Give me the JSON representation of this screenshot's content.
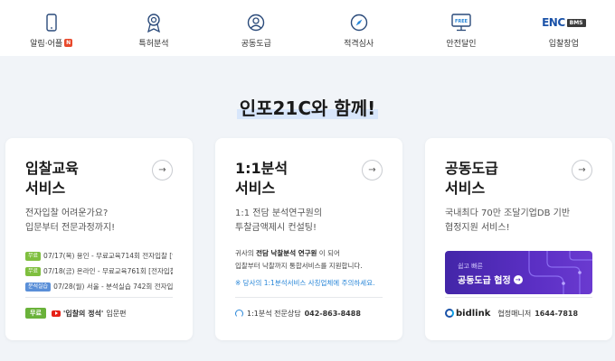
{
  "nav": {
    "items": [
      {
        "label": "알림·어플",
        "badge": "N"
      },
      {
        "label": "특허분석"
      },
      {
        "label": "공동도급"
      },
      {
        "label": "적격심사"
      },
      {
        "label": "안전달인",
        "icon_text": "FREE"
      },
      {
        "label": "입찰창업",
        "logo_text": "ENC",
        "logo_box": "BMS"
      }
    ]
  },
  "headline": "인포21C와 함께!",
  "cards": {
    "education": {
      "title_line1": "입찰교육",
      "title_line2": "서비스",
      "desc_line1": "전자입찰 어려운가요?",
      "desc_line2": "입문부터 전문과정까지!",
      "items": [
        {
          "tag": "무료",
          "text": "07/17(목) 용인 - 무료교육714회 전자입찰 [입..."
        },
        {
          "tag": "무료",
          "text": "07/18(금) 온라인 - 무료교육761회 [전자입찰..."
        },
        {
          "tag": "분석실습",
          "text": "07/28(월) 서울 - 분석실습 742회 전자입..."
        }
      ],
      "footer_badge": "무료",
      "footer_bold": "'입찰의 정석'",
      "footer_text": "입문편"
    },
    "analysis": {
      "title_line1": "1:1분석",
      "title_line2": "서비스",
      "desc_line1": "1:1 전담 분석연구원의",
      "desc_line2": "투찰금액제시 컨설팅!",
      "research_pre": "귀사의 ",
      "research_bold": "전담 낙찰분석 연구원",
      "research_post": " 이 되어",
      "research_line2": "입찰부터 낙찰까지 통합서비스를 지원합니다.",
      "warning": "※ 당사의 1:1분석서비스 사칭업체에 주의하세요.",
      "footer_label": "1:1분석 전문상담",
      "footer_phone": "042-863-8488"
    },
    "joint": {
      "title_line1": "공동도급",
      "title_line2": "서비스",
      "desc_line1": "국내최다 70만 조달기업DB 기반",
      "desc_line2": "협정지원 서비스!",
      "banner_sub": "쉽고 빠른",
      "banner_main": "공동도급 협정",
      "footer_brand": "bidlink",
      "footer_label": "협정매니저",
      "footer_phone": "1644-7818"
    }
  },
  "colors": {
    "background": "#f1f4f8",
    "accent_blue": "#2a87d8",
    "free_green": "#6ab23a",
    "banner_purple": "#5b2fc4"
  }
}
